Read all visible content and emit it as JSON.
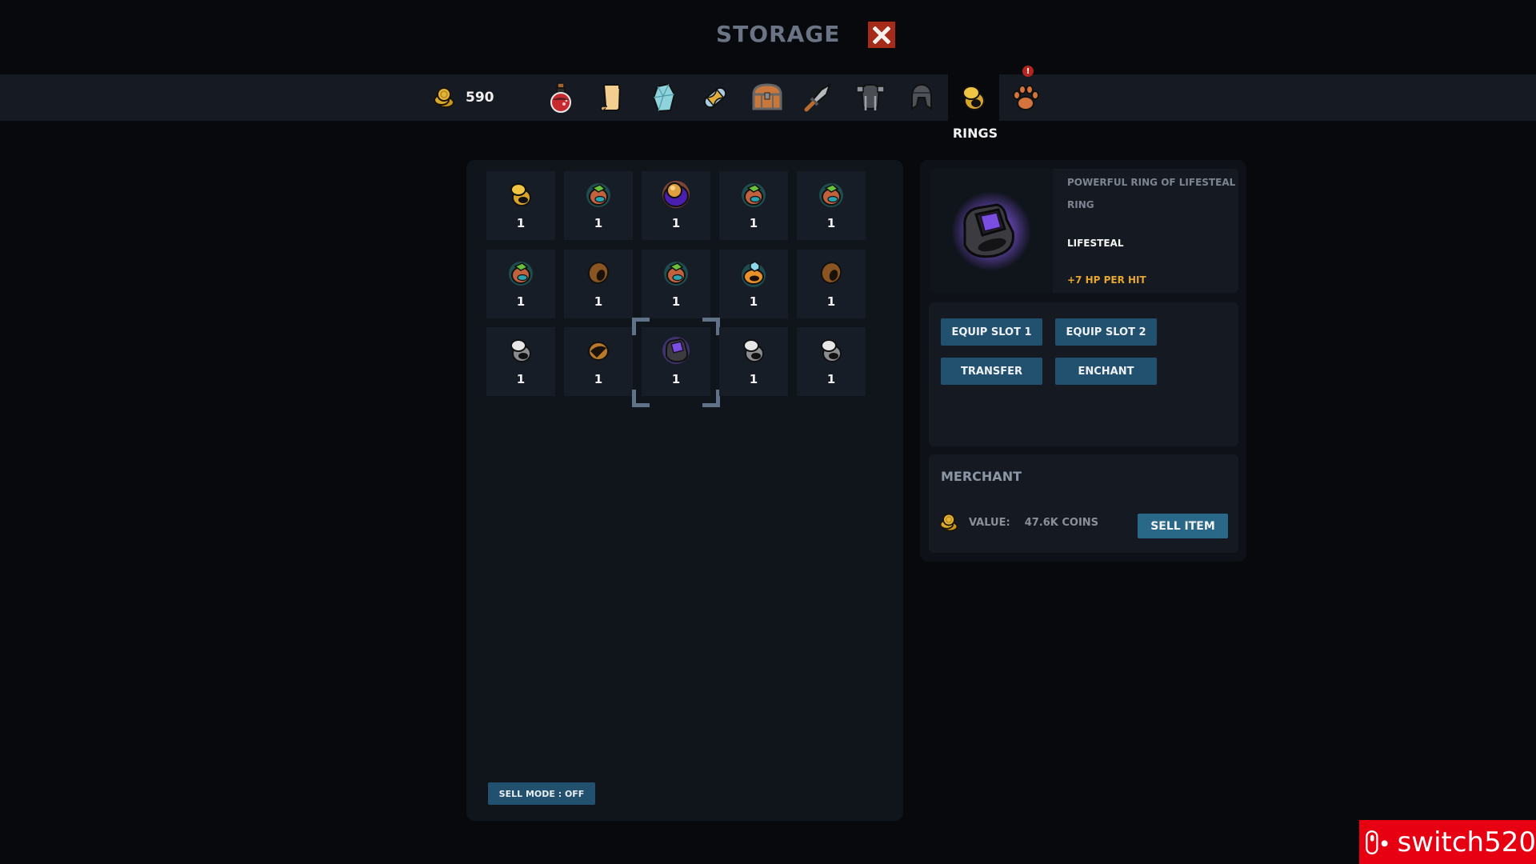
{
  "header": {
    "title": "STORAGE",
    "close_icon": "close-x-icon"
  },
  "currency": {
    "icon": "coins-icon",
    "amount": "590"
  },
  "tabs": [
    {
      "name": "potions",
      "icon": "potion-icon"
    },
    {
      "name": "scrolls",
      "icon": "scroll-icon"
    },
    {
      "name": "crystals",
      "icon": "crystal-icon"
    },
    {
      "name": "materials",
      "icon": "spool-icon"
    },
    {
      "name": "chests",
      "icon": "chest-icon"
    },
    {
      "name": "weapons",
      "icon": "sword-icon"
    },
    {
      "name": "armor",
      "icon": "armor-icon"
    },
    {
      "name": "helmets",
      "icon": "helmet-icon"
    },
    {
      "name": "rings",
      "icon": "ring-icon",
      "active": true
    },
    {
      "name": "pets",
      "icon": "paw-icon",
      "badge": "!"
    }
  ],
  "active_tab_label": "RINGS",
  "pets_badge": "!",
  "colors": {
    "button": "#22506f",
    "sell_button": "#2a6888",
    "close": "#a52a18",
    "bonus": "#e6a630",
    "accent_purple": "#7a4fe0"
  },
  "grid": {
    "rows": [
      [
        {
          "type": "gold-signet",
          "qty": "1"
        },
        {
          "type": "green-gem-copper",
          "qty": "1"
        },
        {
          "type": "orb-purple",
          "qty": "1"
        },
        {
          "type": "green-gem-copper",
          "qty": "1"
        },
        {
          "type": "green-gem-copper",
          "qty": "1"
        }
      ],
      [
        {
          "type": "green-gem-copper",
          "qty": "1"
        },
        {
          "type": "bronze-band",
          "qty": "1"
        },
        {
          "type": "green-gem-copper",
          "qty": "1"
        },
        {
          "type": "blue-gem-orange",
          "qty": "1"
        },
        {
          "type": "bronze-band",
          "qty": "1"
        }
      ],
      [
        {
          "type": "silver-signet",
          "qty": "1"
        },
        {
          "type": "bronze-twist",
          "qty": "1"
        },
        {
          "type": "purple-lifesteal",
          "qty": "1",
          "selected": true
        },
        {
          "type": "silver-signet",
          "qty": "1"
        },
        {
          "type": "silver-signet",
          "qty": "1"
        }
      ]
    ]
  },
  "sell_mode_label": "SELL MODE : OFF",
  "item_detail": {
    "name": "POWERFUL RING OF LIFESTEAL",
    "type": "RING",
    "stat": "LIFESTEAL",
    "bonus": "+7 HP PER HIT"
  },
  "actions": {
    "equip_slot_1": "EQUIP SLOT 1",
    "equip_slot_2": "EQUIP SLOT 2",
    "transfer": "TRANSFER",
    "enchant": "ENCHANT"
  },
  "merchant": {
    "title": "MERCHANT",
    "value_label": "VALUE:",
    "value_amount": "47.6K COINS",
    "sell_button": "SELL ITEM"
  },
  "watermark": {
    "text": "switch520"
  }
}
